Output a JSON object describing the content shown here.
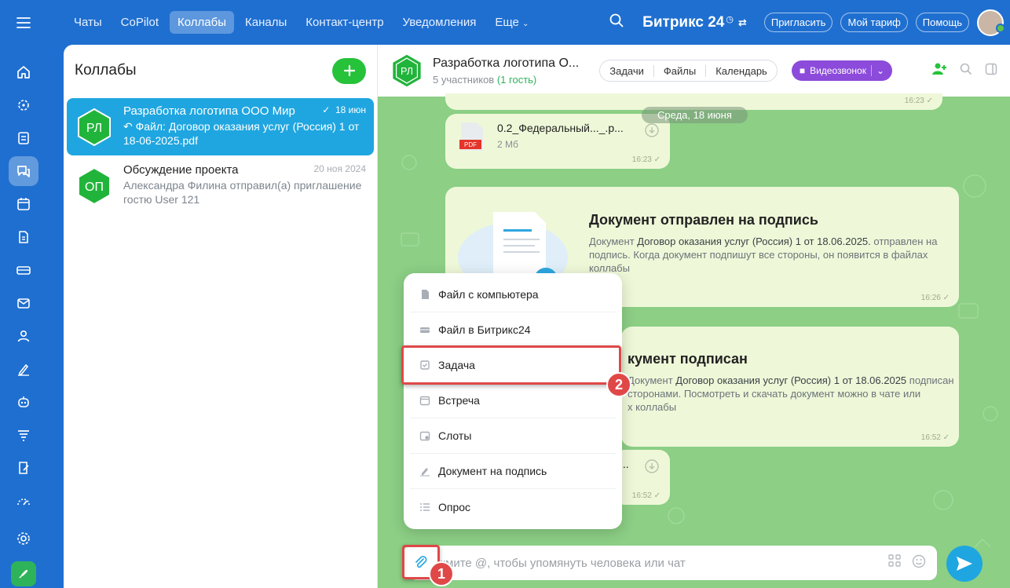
{
  "topnav": {
    "items": [
      "Чаты",
      "CoPilot",
      "Коллабы",
      "Каналы",
      "Контакт-центр",
      "Уведомления",
      "Еще"
    ],
    "active": "Коллабы",
    "brand": "Битрикс 24",
    "invite": "Пригласить",
    "tariff": "Мой тариф",
    "help": "Помощь"
  },
  "list": {
    "title": "Коллабы",
    "chats": [
      {
        "initials": "РЛ",
        "name": "Разработка логотипа ООО Мир",
        "snippet": "Файл: Договор оказания услуг (Россия) 1 от 18-06-2025.pdf",
        "date": "18 июн"
      },
      {
        "initials": "ОП",
        "name": "Обсуждение проекта",
        "snippet": "Александра Филина отправил(а) приглашение гостю User 121",
        "date": "20 ноя 2024"
      }
    ]
  },
  "chat": {
    "initials": "РЛ",
    "title": "Разработка логотипа О...",
    "members": "5 участников",
    "guests": "(1 гость)",
    "tabs": [
      "Задачи",
      "Файлы",
      "Календарь"
    ],
    "video": "Видеозвонок",
    "date_badge": "Среда, 18 июня",
    "file": {
      "name": "0.2_Федеральный..._.р...",
      "size": "2 Мб",
      "badge": "PDF"
    },
    "times": {
      "t1": "16:23",
      "t2": "16:23",
      "t3": "16:26",
      "t4": "16:52",
      "t5": "16:52"
    },
    "doc_sent": {
      "title": "Документ отправлен на подпись",
      "pre": "Документ ",
      "doc": "Договор оказания услуг (Россия) 1 от 18.06.2025.",
      "post": "отправлен на подпись. Когда документ подпишут все стороны, он появится в файлах коллабы"
    },
    "doc_signed": {
      "title": "кумент подписан",
      "pre": "Документ ",
      "doc": "Договор оказания услуг (Россия) 1 от 18.06.2025",
      "post": "подписан",
      "line2": "сторонами. Посмотреть и скачать документ можно в чате или",
      "line3": "х коллабы"
    },
    "file2_snip": "...",
    "composer_placeholder": "жмите @, чтобы упомянуть человека или чат"
  },
  "attach_menu": [
    {
      "label": "Файл с компьютера",
      "icon": "file-icon"
    },
    {
      "label": "Файл в Битрикс24",
      "icon": "drive-icon"
    },
    {
      "label": "Задача",
      "icon": "task-icon"
    },
    {
      "label": "Встреча",
      "icon": "calendar-icon"
    },
    {
      "label": "Слоты",
      "icon": "slots-icon"
    },
    {
      "label": "Документ на подпись",
      "icon": "sign-icon"
    },
    {
      "label": "Опрос",
      "icon": "poll-icon"
    }
  ],
  "steps": {
    "one": "1",
    "two": "2"
  },
  "colors": {
    "accent": "#1fa6e0",
    "green": "#26c23a",
    "highlight": "#e04848",
    "video": "#8c4bdb"
  }
}
